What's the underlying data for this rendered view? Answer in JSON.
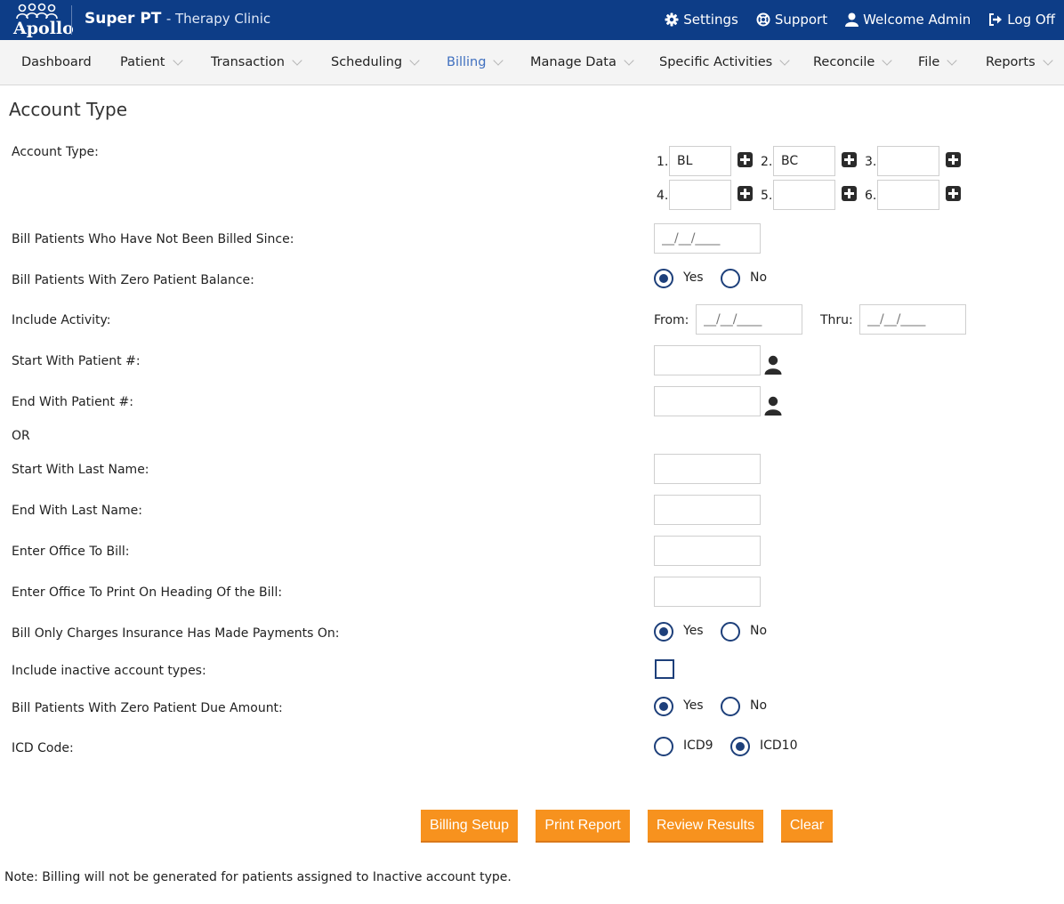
{
  "header": {
    "logo_text": "Apollo",
    "brand": "Super PT",
    "brand_sub": "- Therapy Clinic",
    "links": {
      "settings": "Settings",
      "support": "Support",
      "welcome": "Welcome Admin",
      "logoff": "Log Off"
    }
  },
  "nav": {
    "items": [
      "Dashboard",
      "Patient",
      "Transaction",
      "Scheduling",
      "Billing",
      "Manage Data",
      "Specific Activities",
      "Reconcile",
      "File",
      "Reports"
    ],
    "active": "Billing"
  },
  "page": {
    "title": "Account Type"
  },
  "form": {
    "account_type_label": "Account Type:",
    "account_nums": [
      "1.",
      "2.",
      "3.",
      "4.",
      "5.",
      "6."
    ],
    "account_values": [
      "BL",
      "BC",
      "",
      "",
      "",
      ""
    ],
    "bill_since_label": "Bill Patients Who Have Not Been Billed Since:",
    "date_placeholder": "__/__/____",
    "zero_balance_label": "Bill Patients With Zero Patient Balance:",
    "yes": "Yes",
    "no": "No",
    "include_activity_label": "Include Activity:",
    "from_label": "From:",
    "thru_label": "Thru:",
    "start_patient_label": "Start With Patient #:",
    "end_patient_label": "End With Patient #:",
    "or_label": "OR",
    "start_last_label": "Start With Last Name:",
    "end_last_label": "End With Last Name:",
    "office_bill_label": "Enter Office To Bill:",
    "office_heading_label": "Enter Office To Print On Heading Of the Bill:",
    "insurance_paid_label": "Bill Only Charges Insurance Has Made Payments On:",
    "inactive_label": "Include inactive account types:",
    "zero_due_label": "Bill Patients With Zero Patient Due Amount:",
    "icd_label": "ICD Code:",
    "icd9": "ICD9",
    "icd10": "ICD10",
    "zero_balance_selected": "Yes",
    "insurance_paid_selected": "Yes",
    "zero_due_selected": "Yes",
    "icd_selected": "ICD10",
    "include_inactive_checked": false
  },
  "buttons": {
    "billing_setup": "Billing Setup",
    "print_report": "Print Report",
    "review_results": "Review Results",
    "clear": "Clear"
  },
  "note": "Note: Billing will not be generated for patients assigned to Inactive account type.",
  "colors": {
    "header_bg": "#0d3d87",
    "accent": "#f7921e",
    "radio": "#1d3f7a",
    "nav_active": "#3f6fbf"
  }
}
